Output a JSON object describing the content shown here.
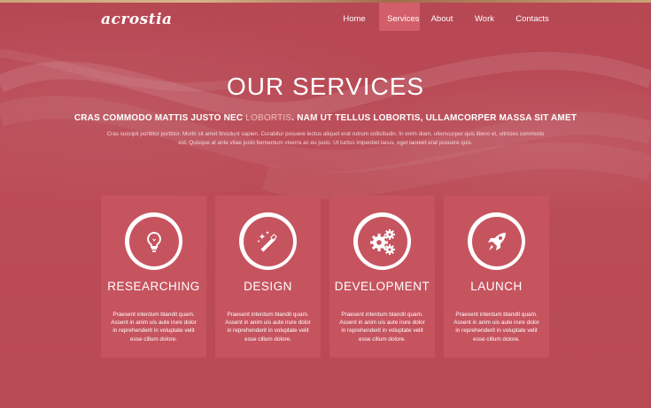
{
  "header": {
    "logo": "acrostia",
    "nav": [
      "Home",
      "Services",
      "About",
      "Work",
      "Contacts"
    ],
    "active_nav": "Services"
  },
  "hero": {
    "title": "OUR SERVICES",
    "subtitle_before": "CRAS COMMODO MATTIS JUSTO NEC ",
    "subtitle_highlight": "LOBORTIS",
    "subtitle_after": ". NAM UT TELLUS LOBORTIS, ULLAMCORPER MASSA SIT AMET",
    "description": "Cras suscipit porttitor porttitor. Morbi sit amet tincidunt sapien. Curabitur posuere lectus aliquet erat rutrum sollicitudin. In enim diam, ullamcorper quis libero et, ultricies commodo est. Quisque at ante vitae justo fermentum viverra ac eu justo. Ut luctus imperdiet lacus, eget laoreet erat posuere quis."
  },
  "services": [
    {
      "title": "RESEARCHING",
      "icon": "lightbulb-icon",
      "text": "Praesent interdum blandit quam. Assent in anim uis aute irure dolor in reprehenderit in voluptate velit esse cillum dolore."
    },
    {
      "title": "DESIGN",
      "icon": "magic-wand-icon",
      "text": "Praesent interdum blandit quam. Assent in anim uis aute irure dolor in reprehenderit in voluptate velit esse cillum dolore."
    },
    {
      "title": "DEVELOPMENT",
      "icon": "gears-icon",
      "text": "Praesent interdum blandit quam. Assent in anim uis aute irure dolor in reprehenderit in voluptate velit esse cillum dolore."
    },
    {
      "title": "LAUNCH",
      "icon": "rocket-icon",
      "text": "Praesent interdum blandit quam. Assent in anim uis aute irure dolor in reprehenderit in voluptate velit esse cillum dolore."
    }
  ],
  "colors": {
    "background": "#b84a55",
    "card": "#c6545f",
    "nav_active": "#d25e69",
    "highlight": "#f2b8b7"
  }
}
